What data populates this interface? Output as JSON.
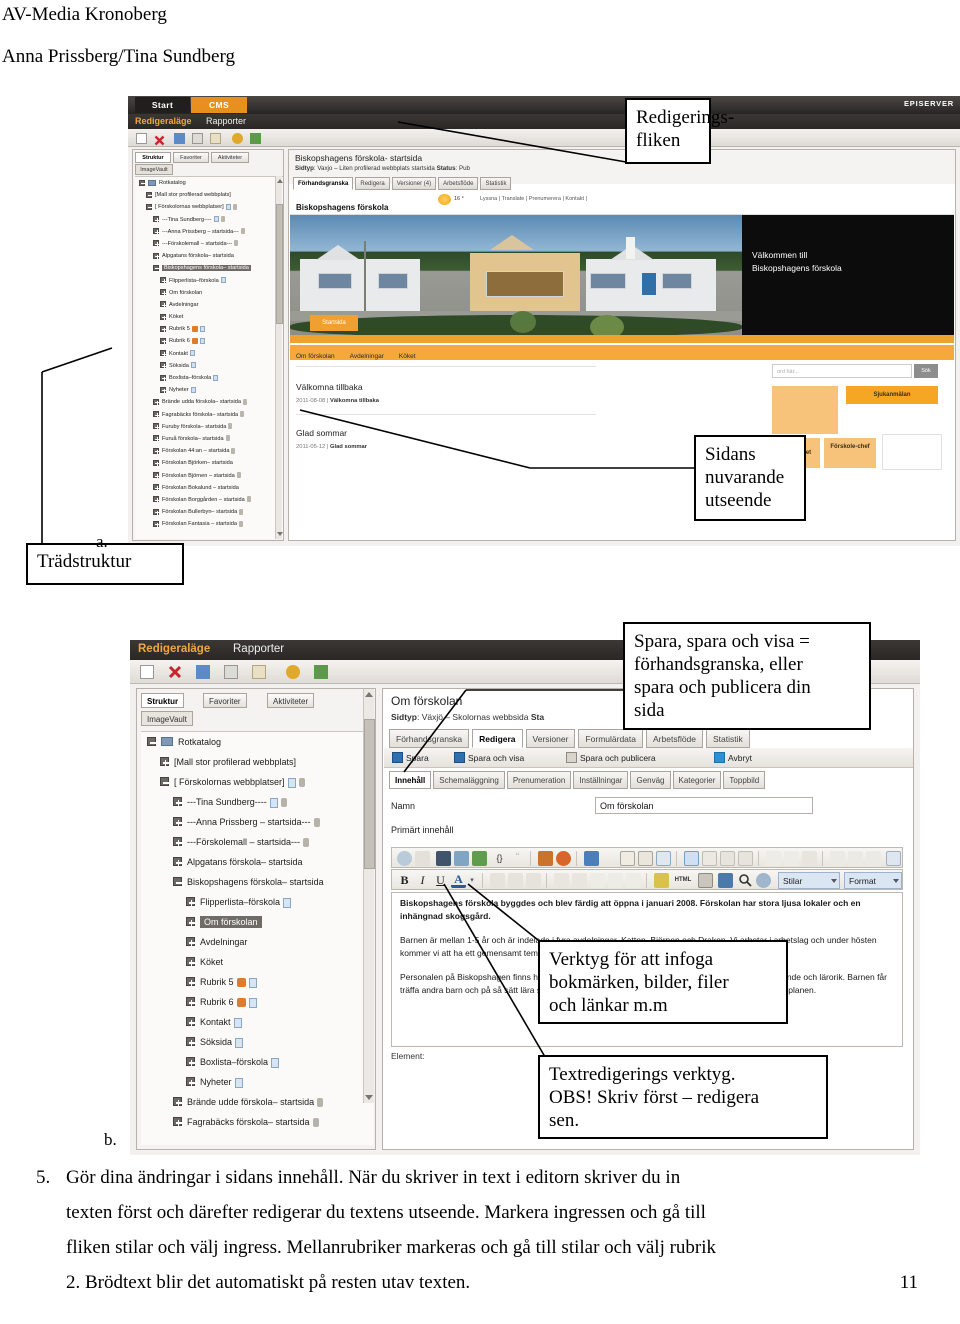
{
  "document": {
    "title": "AV-Media Kronoberg",
    "author": "Anna Prissberg/Tina Sundberg",
    "page_number": "11"
  },
  "callouts": {
    "editing_tab": "Redigerings-\nfliken",
    "editing_tab_line1": "Redigerings-",
    "editing_tab_line2": "fliken",
    "current_look_line1": "Sidans",
    "current_look_line2": "nuvarande",
    "current_look_line3": "utseende",
    "tree_structure": "Trädstruktur",
    "save_info_line1": "Spara, spara och visa  =",
    "save_info_line2": "förhandsgranska, eller",
    "save_info_line3": "spara och publicera din",
    "save_info_line4": "sida",
    "insert_tools_line1": "Verktyg för att infoga",
    "insert_tools_line2": "bokmärken, bilder, filer",
    "insert_tools_line3": "och länkar m.m",
    "text_tools_line1": "Textredigerings verktyg.",
    "text_tools_line2": "OBS! Skriv först – redigera",
    "text_tools_line3": "sen.",
    "marker_a": "a.",
    "marker_b": "b."
  },
  "instructions": {
    "number": "5.",
    "line1": "Gör dina ändringar i sidans innehåll.  När du skriver in text i editorn skriver du in",
    "line2": "texten först och därefter redigerar du textens utseende. Markera ingressen och gå till",
    "line3": "fliken stilar och välj ingress. Mellanrubriker markeras och gå till stilar och välj rubrik",
    "line4": "2. Brödtext blir det automatiskt på resten utav texten."
  },
  "shot1": {
    "global_bar": {
      "tab_start": "Start",
      "tab_cms": "CMS",
      "logo": "EPISERVER"
    },
    "menu": {
      "item1": "Redigeraläge",
      "item2": "Rapporter"
    },
    "tree_tabs": [
      "Struktur",
      "Favoriter",
      "Aktiviteter",
      "ImageVault"
    ],
    "tree_nodes": [
      {
        "label": "Rotkatalog",
        "indent": 0,
        "expanded": true,
        "folder": true
      },
      {
        "label": "[Mall stor profilerad webbplats]",
        "indent": 1,
        "expanded": true
      },
      {
        "label": "[ Förskolornas webbplatser]",
        "indent": 1,
        "expanded": true,
        "doc": true,
        "lock": true
      },
      {
        "label": "---Tina Sundberg----",
        "indent": 2,
        "doc": true,
        "lock": true
      },
      {
        "label": "---Anna Prissberg – startsida---",
        "indent": 2,
        "lock": true
      },
      {
        "label": "---Förskolemall – startsida---",
        "indent": 2,
        "lock": true
      },
      {
        "label": "Alpgatans förskola– startsida",
        "indent": 2
      },
      {
        "label": "Biskopshagens förskola– startsida",
        "indent": 2,
        "selected": true,
        "expanded": true
      },
      {
        "label": "Flipperlista–förskola",
        "indent": 3,
        "doc": true
      },
      {
        "label": "Om förskolan",
        "indent": 3
      },
      {
        "label": "Avdelningar",
        "indent": 3
      },
      {
        "label": "Köket",
        "indent": 3
      },
      {
        "label": "Rubrik 5",
        "indent": 3,
        "warn": true,
        "doc": true
      },
      {
        "label": "Rubrik 6",
        "indent": 3,
        "warn": true,
        "doc": true
      },
      {
        "label": "Kontakt",
        "indent": 3,
        "doc": true
      },
      {
        "label": "Söksida",
        "indent": 3,
        "doc": true
      },
      {
        "label": "Boxlista–förskola",
        "indent": 3,
        "doc": true
      },
      {
        "label": "Nyheter",
        "indent": 3,
        "doc": true
      },
      {
        "label": "Brände udda förskola– startsida",
        "indent": 2,
        "lock": true
      },
      {
        "label": "Fagrabäcks förskola– startsida",
        "indent": 2,
        "lock": true
      },
      {
        "label": "Furuby förskola– startsida",
        "indent": 2,
        "lock": true
      },
      {
        "label": "Furuå förskola– startsida",
        "indent": 2,
        "lock": true
      },
      {
        "label": "Förskolan 44:an – startsida",
        "indent": 2,
        "lock": true
      },
      {
        "label": "Förskolan Björken– startsida",
        "indent": 2
      },
      {
        "label": "Förskolan Björnen – startsida",
        "indent": 2,
        "lock": true
      },
      {
        "label": "Förskolan Bokalund – startsida",
        "indent": 2
      },
      {
        "label": "Förskolan Borggården – startsida",
        "indent": 2,
        "lock": true
      },
      {
        "label": "Förskolan Bullerbyn– startsida",
        "indent": 2,
        "lock": true
      },
      {
        "label": "Förskolan Fantasia – startsida",
        "indent": 2,
        "lock": true
      }
    ],
    "page_title": "Biskopshagens förskola- startsida",
    "page_meta_label1": "Sidtyp",
    "page_meta_value1": ": Vaxjo – Liten profilerad webbplats startsida ",
    "page_meta_label2": "Status",
    "page_meta_value2": ": Pub",
    "tabs": [
      "Förhandsgranska",
      "Redigera",
      "Versioner (4)",
      "Arbetsflöde",
      "Statistik"
    ],
    "site": {
      "logo": "Biskopshagens förskola",
      "temperature": "16 °",
      "utility": "Lyssna  |  Translate  |  Prenumerera  |  Kontakt  |",
      "hero_line1": "Välkommen till",
      "hero_line2": "Biskopshagens förskola",
      "hero_button": "Startsida",
      "nav": [
        "Om förskolan",
        "Avdelningar",
        "Köket"
      ],
      "news": [
        {
          "heading": "Välkomna tillbaka",
          "meta_date": "2011-08-08",
          "meta_text": "Välkomna tillbaka"
        },
        {
          "heading": "Glad sommar",
          "meta_date": "2011-05-12",
          "meta_text": "Glad sommar"
        }
      ],
      "search_placeholder": "ord här...",
      "search_button": "Sök",
      "tiles": [
        "Sjukanmälan",
        "Skolverket",
        "Förskole-chef"
      ]
    }
  },
  "shot2": {
    "menu": {
      "item1": "Redigeraläge",
      "item2": "Rapporter"
    },
    "tree_tabs": [
      "Struktur",
      "Favoriter",
      "Aktiviteter",
      "ImageVault"
    ],
    "tree_nodes": [
      {
        "label": "Rotkatalog",
        "indent": 0,
        "expanded": true,
        "folder": true
      },
      {
        "label": "[Mall stor profilerad webbplats]",
        "indent": 1
      },
      {
        "label": "[ Förskolornas webbplatser]",
        "indent": 1,
        "expanded": true,
        "doc": true,
        "lock": true
      },
      {
        "label": "---Tina Sundberg----",
        "indent": 2,
        "doc": true,
        "lock": true
      },
      {
        "label": "---Anna Prissberg – startsida---",
        "indent": 2,
        "lock": true
      },
      {
        "label": "---Förskolemall – startsida---",
        "indent": 2,
        "lock": true
      },
      {
        "label": "Alpgatans förskola– startsida",
        "indent": 2
      },
      {
        "label": "Biskopshagens förskola– startsida",
        "indent": 2,
        "expanded": true
      },
      {
        "label": "Flipperlista–förskola",
        "indent": 3,
        "doc": true
      },
      {
        "label": "Om förskolan",
        "indent": 3,
        "selected": true
      },
      {
        "label": "Avdelningar",
        "indent": 3
      },
      {
        "label": "Köket",
        "indent": 3
      },
      {
        "label": "Rubrik 5",
        "indent": 3,
        "warn": true,
        "doc": true
      },
      {
        "label": "Rubrik 6",
        "indent": 3,
        "warn": true,
        "doc": true
      },
      {
        "label": "Kontakt",
        "indent": 3,
        "doc": true
      },
      {
        "label": "Söksida",
        "indent": 3,
        "doc": true
      },
      {
        "label": "Boxlista–förskola",
        "indent": 3,
        "doc": true
      },
      {
        "label": "Nyheter",
        "indent": 3,
        "doc": true
      },
      {
        "label": "Brände udde förskola– startsida",
        "indent": 2,
        "lock": true
      },
      {
        "label": "Fagrabäcks förskola– startsida",
        "indent": 2,
        "lock": true
      }
    ],
    "page_title": "Om förskolan",
    "page_meta_label1": "Sidtyp",
    "page_meta_value1": ": Växjö – Skolornas webbsida ",
    "page_meta_label2": "Sta",
    "tabs": [
      "Förhandsgranska",
      "Redigera",
      "Versioner",
      "Formulärdata",
      "Arbetsflöde",
      "Statistik"
    ],
    "save_actions": [
      "Spara",
      "Spara och visa",
      "Spara och publicera",
      "Avbryt"
    ],
    "content_tabs": [
      "Innehåll",
      "Schemaläggning",
      "Prenumeration",
      "Inställningar",
      "Genväg",
      "Kategorier",
      "Toppbild"
    ],
    "name_label": "Namn",
    "name_value": "Om förskolan",
    "primary_label": "Primärt innehåll",
    "style_select": "Stilar",
    "format_select": "Format",
    "element_label": "Element:",
    "body": {
      "p1": "Biskopshagens förskola byggdes och blev färdig att öppna i januari 2008. Förskolan har stora ljusa lokaler och en inhängnad skogsgård.",
      "p2": "Barnen är mellan 1-5 år och är indelade i fyra avdelningar, Katten, Björnen och Draken. Vi arbetar i arbetslag och under hösten kommer vi att ha ett gemensamt tema.",
      "p3": "Personalen på Biskopshagen finns här för era barn. Vi vill att tiden på förskolan skall vara rolig, spännande och lärorik. Barnen får träffa andra barn och på så sätt lära sig sociala regler. Verksamheten utformas och planeras utifrån läroplanen."
    }
  }
}
